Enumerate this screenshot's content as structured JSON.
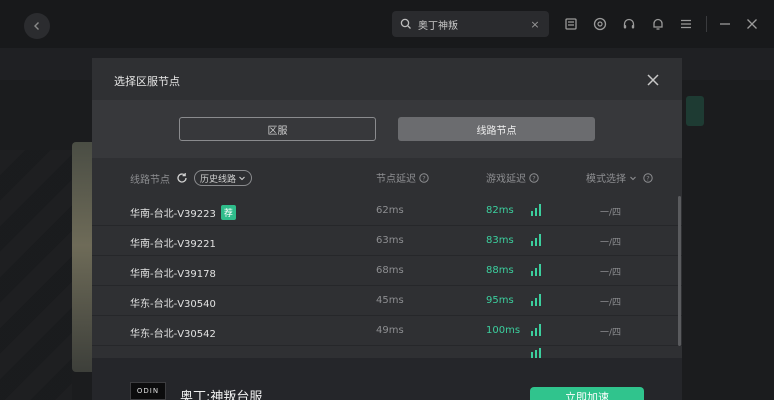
{
  "search": {
    "value": "奥丁神叛",
    "clear": "×"
  },
  "modal": {
    "title": "选择区服节点",
    "tabs": {
      "region": "区服",
      "line_node": "线路节点"
    },
    "header": {
      "line_node": "线路节点",
      "history": "历史线路",
      "node_latency": "节点延迟",
      "game_latency": "游戏延迟",
      "mode_select": "模式选择"
    },
    "rows": [
      {
        "name": "华南-台北-V39223",
        "badge": "荐",
        "node_ping": "62ms",
        "game_ping": "82ms",
        "mode": "一/四"
      },
      {
        "name": "华南-台北-V39221",
        "badge": "",
        "node_ping": "63ms",
        "game_ping": "83ms",
        "mode": "一/四"
      },
      {
        "name": "华南-台北-V39178",
        "badge": "",
        "node_ping": "68ms",
        "game_ping": "88ms",
        "mode": "一/四"
      },
      {
        "name": "华东-台北-V30540",
        "badge": "",
        "node_ping": "45ms",
        "game_ping": "95ms",
        "mode": "一/四"
      },
      {
        "name": "华东-台北-V30542",
        "badge": "",
        "node_ping": "49ms",
        "game_ping": "100ms",
        "mode": "一/四"
      }
    ]
  },
  "game": {
    "logo": "ODIN",
    "name": "奥丁:神叛台服",
    "button": "立即加速"
  },
  "colors": {
    "accent": "#30c48d",
    "latency_good": "#3ccf9e",
    "modal_bg": "#2f3033"
  }
}
